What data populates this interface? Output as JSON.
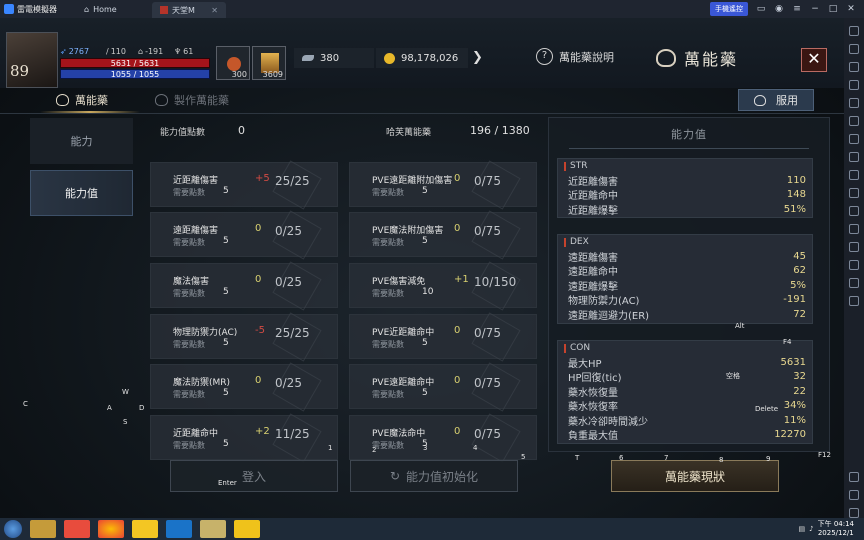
{
  "emulator": {
    "app_name": "雷電模擬器",
    "tabs": [
      {
        "label": "Home"
      },
      {
        "label": "天堂M"
      }
    ],
    "keyboard_btn": "手機遙控"
  },
  "hud": {
    "level": "89",
    "stats_mini": {
      "power": "2767",
      "a": "110",
      "b": "-191",
      "c": "61"
    },
    "hp": "5631 / 5631",
    "mp": "1055 / 1055",
    "slot1_count": "300",
    "slot2_count": "3609",
    "feathers": "380",
    "adena": "98,178,026",
    "help_label": "萬能藥說明",
    "title": "萬能藥",
    "close_label": "✕"
  },
  "tabs": {
    "active": "萬能藥",
    "inactive": "製作萬能藥",
    "use_button": "服用"
  },
  "subnav": [
    "能力",
    "能力值"
  ],
  "points": {
    "label_left": "能力值點數",
    "value_left": "0",
    "label_right": "哈芙萬能藥",
    "value_right": "196 / 1380"
  },
  "need_label": "需要點數",
  "cards_left": [
    {
      "name": "近距離傷害",
      "need": "5",
      "bonus": "+5",
      "ratio": "25/25",
      "kind": "neg"
    },
    {
      "name": "遠距離傷害",
      "need": "5",
      "bonus": "0",
      "ratio": "0/25",
      "kind": "zero"
    },
    {
      "name": "魔法傷害",
      "need": "5",
      "bonus": "0",
      "ratio": "0/25",
      "kind": "zero"
    },
    {
      "name": "物理防禦力(AC)",
      "need": "5",
      "bonus": "-5",
      "ratio": "25/25",
      "kind": "neg"
    },
    {
      "name": "魔法防禦(MR)",
      "need": "5",
      "bonus": "0",
      "ratio": "0/25",
      "kind": "zero"
    },
    {
      "name": "近距離命中",
      "need": "5",
      "bonus": "+2",
      "ratio": "11/25",
      "kind": "pos"
    }
  ],
  "cards_right": [
    {
      "name": "PVE遠距離附加傷害",
      "need": "5",
      "bonus": "0",
      "ratio": "0/75",
      "kind": "zero"
    },
    {
      "name": "PVE魔法附加傷害",
      "need": "5",
      "bonus": "0",
      "ratio": "0/75",
      "kind": "zero"
    },
    {
      "name": "PVE傷害減免",
      "need": "10",
      "bonus": "+1",
      "ratio": "10/150",
      "kind": "pos"
    },
    {
      "name": "PVE近距離命中",
      "need": "5",
      "bonus": "0",
      "ratio": "0/75",
      "kind": "zero"
    },
    {
      "name": "PVE遠距離命中",
      "need": "5",
      "bonus": "0",
      "ratio": "0/75",
      "kind": "zero"
    },
    {
      "name": "PVE魔法命中",
      "need": "5",
      "bonus": "0",
      "ratio": "0/75",
      "kind": "zero"
    }
  ],
  "panel": {
    "title": "能力值",
    "groups": [
      {
        "name": "STR",
        "rows": [
          {
            "k": "近距離傷害",
            "v": "110"
          },
          {
            "k": "近距離命中",
            "v": "148"
          },
          {
            "k": "近距離爆擊",
            "v": "51%"
          }
        ]
      },
      {
        "name": "DEX",
        "rows": [
          {
            "k": "遠距離傷害",
            "v": "45"
          },
          {
            "k": "遠距離命中",
            "v": "62"
          },
          {
            "k": "遠距離爆擊",
            "v": "5%"
          },
          {
            "k": "物理防禦力(AC)",
            "v": "-191"
          },
          {
            "k": "遠距離迴避力(ER)",
            "v": "72"
          }
        ]
      },
      {
        "name": "CON",
        "rows": [
          {
            "k": "最大HP",
            "v": "5631"
          },
          {
            "k": "HP回復(tic)",
            "v": "32"
          },
          {
            "k": "藥水恢復量",
            "v": "22"
          },
          {
            "k": "藥水恢復率",
            "v": "34%"
          },
          {
            "k": "藥水冷卻時間減少",
            "v": "11%"
          },
          {
            "k": "負重最大值",
            "v": "12270"
          }
        ]
      }
    ]
  },
  "bottom": {
    "btn1": "登入",
    "btn2": "能力值初始化",
    "btn3": "萬能藥現狀"
  },
  "keymap": {
    "enter": "Enter",
    "alt": "Alt",
    "f4": "F4",
    "space": "空格",
    "delete": "Delete",
    "f12": "F12",
    "c": "C",
    "w": "W",
    "a": "A",
    "d": "D",
    "s": "S",
    "n1": "1",
    "n2": "2",
    "n3": "3",
    "n4": "4",
    "n5": "5",
    "t": "T",
    "n6": "6",
    "n7": "7",
    "n8": "8",
    "n9": "9"
  },
  "taskbar": {
    "time": "下午 04:14",
    "date": "2025/12/1"
  }
}
